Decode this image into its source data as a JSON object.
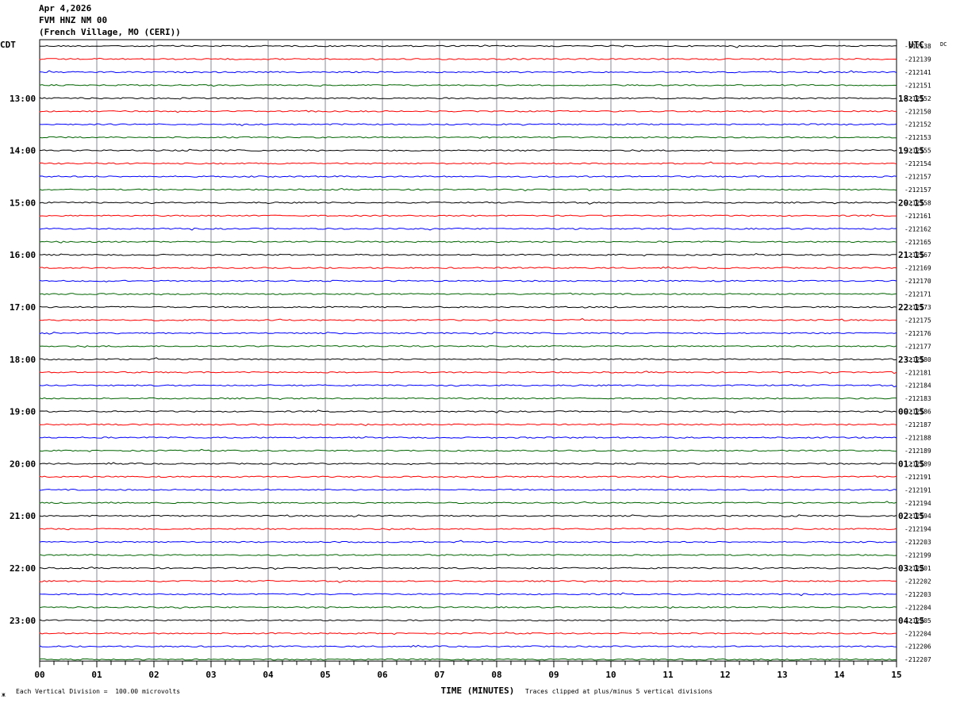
{
  "header": {
    "date": "Apr 4,2026",
    "station": "FVM HNZ NM 00",
    "location": "(French Village, MO (CERI))"
  },
  "axes": {
    "left_zone": "CDT",
    "right_zone": "UTC",
    "dc_label": "DC",
    "xlabel": "TIME (MINUTES)"
  },
  "footer": {
    "scale_note": "Each Vertical Division =  100.00 microvolts",
    "clip_note": "Traces clipped at plus/minus 5 vertical divisions",
    "corner_mark": "ж"
  },
  "chart_data": {
    "type": "line",
    "x_ticks": [
      "00",
      "01",
      "02",
      "03",
      "04",
      "05",
      "06",
      "07",
      "08",
      "09",
      "10",
      "11",
      "12",
      "13",
      "14",
      "15"
    ],
    "xlim": [
      0,
      15
    ],
    "trace_colors": [
      "#000000",
      "#ff0000",
      "#0000ff",
      "#006400"
    ],
    "hour_rows": [
      {
        "left": "13:00",
        "right": "18:15",
        "row": 4
      },
      {
        "left": "14:00",
        "right": "19:15",
        "row": 8
      },
      {
        "left": "15:00",
        "right": "20:15",
        "row": 12
      },
      {
        "left": "16:00",
        "right": "21:15",
        "row": 16
      },
      {
        "left": "17:00",
        "right": "22:15",
        "row": 20
      },
      {
        "left": "18:00",
        "right": "23:15",
        "row": 24
      },
      {
        "left": "19:00",
        "right": "00:15",
        "row": 28
      },
      {
        "left": "20:00",
        "right": "01:15",
        "row": 32
      },
      {
        "left": "21:00",
        "right": "02:15",
        "row": 36
      },
      {
        "left": "22:00",
        "right": "03:15",
        "row": 40
      },
      {
        "left": "23:00",
        "right": "04:15",
        "row": 44
      }
    ],
    "dc_offsets": [
      "-212138",
      "-212139",
      "-212141",
      "-212151",
      "-212152",
      "-212150",
      "-212152",
      "-212153",
      "-212155",
      "-212154",
      "-212157",
      "-212157",
      "-212158",
      "-212161",
      "-212162",
      "-212165",
      "-212167",
      "-212169",
      "-212170",
      "-212171",
      "-212173",
      "-212175",
      "-212176",
      "-212177",
      "-212180",
      "-212181",
      "-212184",
      "-212183",
      "-212186",
      "-212187",
      "-212188",
      "-212189",
      "-212189",
      "-212191",
      "-212191",
      "-212194",
      "-212194",
      "-212194",
      "-212203",
      "-212199",
      "-212201",
      "-212202",
      "-212203",
      "-212204",
      "-212205",
      "-212204",
      "-212206",
      "-212207"
    ]
  }
}
